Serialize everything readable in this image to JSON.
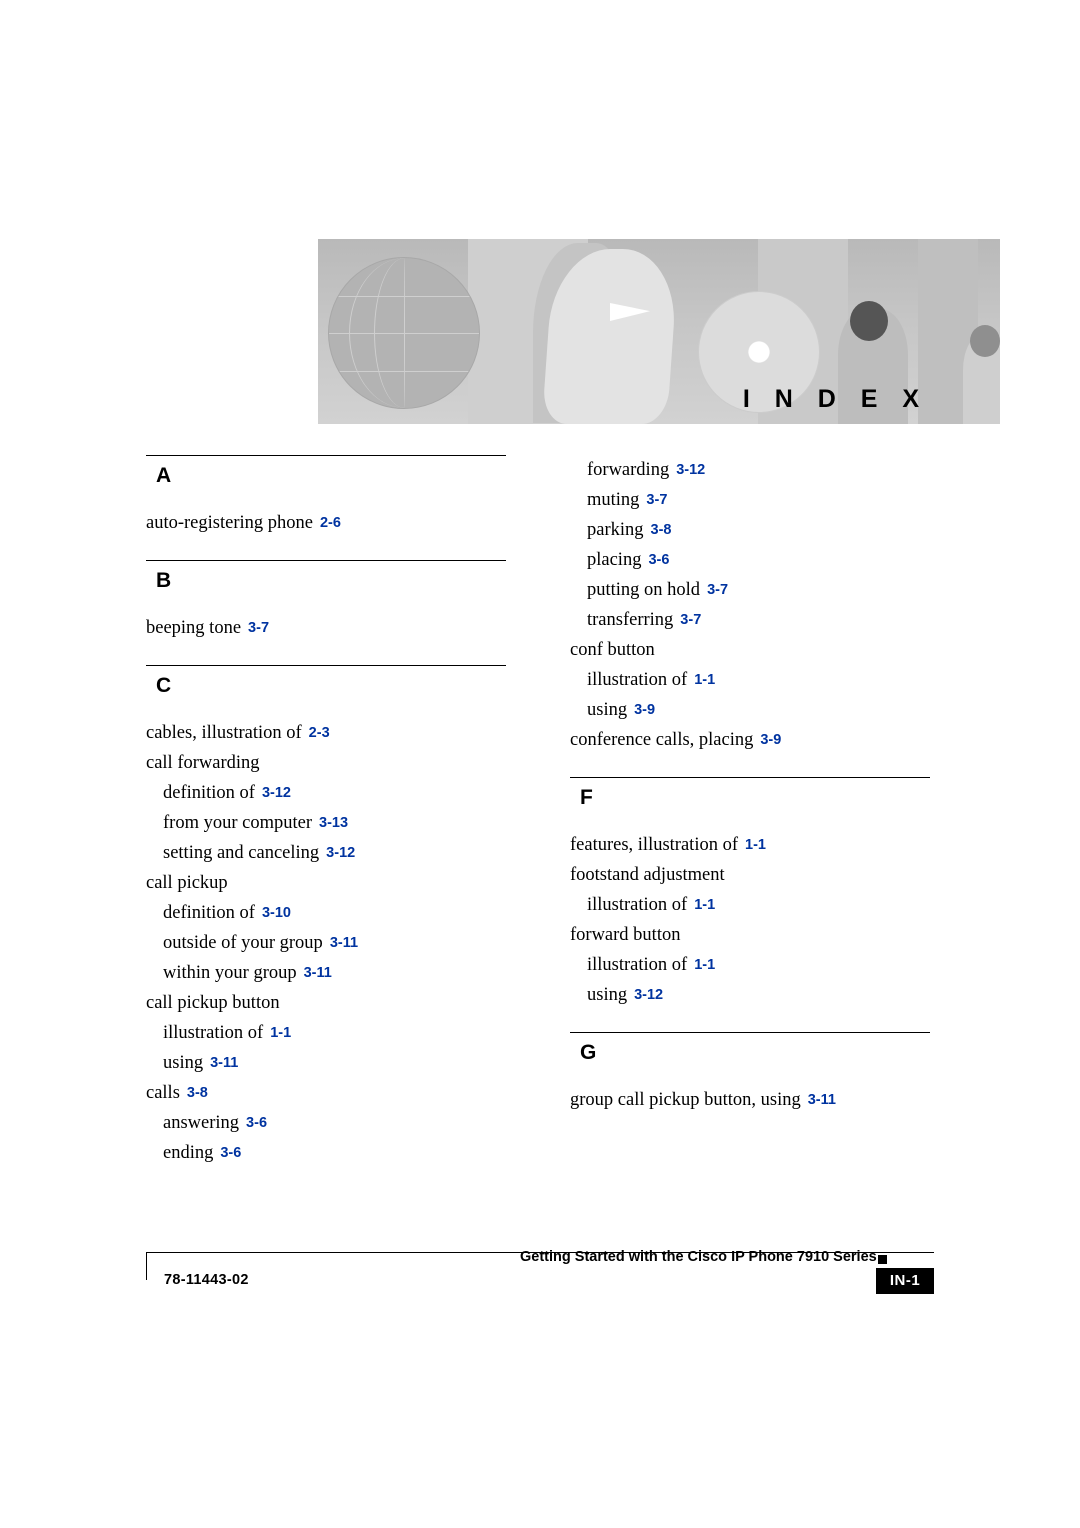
{
  "banner": {
    "title": "I N D E X",
    "graphic": "index-banner-illustration"
  },
  "columns": [
    {
      "id": "left",
      "sections": [
        {
          "letter": "A",
          "entries": [
            {
              "level": 0,
              "text": "auto-registering phone",
              "page": "2-6"
            }
          ]
        },
        {
          "letter": "B",
          "entries": [
            {
              "level": 0,
              "text": "beeping tone",
              "page": "3-7"
            }
          ]
        },
        {
          "letter": "C",
          "entries": [
            {
              "level": 0,
              "text": "cables, illustration of",
              "page": "2-3"
            },
            {
              "level": 0,
              "text": "call forwarding",
              "page": ""
            },
            {
              "level": 1,
              "text": "definition of",
              "page": "3-12"
            },
            {
              "level": 1,
              "text": "from your computer",
              "page": "3-13"
            },
            {
              "level": 1,
              "text": "setting and canceling",
              "page": "3-12"
            },
            {
              "level": 0,
              "text": "call pickup",
              "page": ""
            },
            {
              "level": 1,
              "text": "definition of",
              "page": "3-10"
            },
            {
              "level": 1,
              "text": "outside of your group",
              "page": "3-11"
            },
            {
              "level": 1,
              "text": "within your group",
              "page": "3-11"
            },
            {
              "level": 0,
              "text": "call pickup button",
              "page": ""
            },
            {
              "level": 1,
              "text": "illustration of",
              "page": "1-1"
            },
            {
              "level": 1,
              "text": "using",
              "page": "3-11"
            },
            {
              "level": 0,
              "text": "calls",
              "page": "3-8"
            },
            {
              "level": 1,
              "text": "answering",
              "page": "3-6"
            },
            {
              "level": 1,
              "text": "ending",
              "page": "3-6"
            }
          ]
        }
      ]
    },
    {
      "id": "right",
      "sections": [
        {
          "letter": "",
          "entries": [
            {
              "level": 1,
              "text": "forwarding",
              "page": "3-12"
            },
            {
              "level": 1,
              "text": "muting",
              "page": "3-7"
            },
            {
              "level": 1,
              "text": "parking",
              "page": "3-8"
            },
            {
              "level": 1,
              "text": "placing",
              "page": "3-6"
            },
            {
              "level": 1,
              "text": "putting on hold",
              "page": "3-7"
            },
            {
              "level": 1,
              "text": "transferring",
              "page": "3-7"
            },
            {
              "level": 0,
              "text": "conf button",
              "page": ""
            },
            {
              "level": 1,
              "text": "illustration of",
              "page": "1-1"
            },
            {
              "level": 1,
              "text": "using",
              "page": "3-9"
            },
            {
              "level": 0,
              "text": "conference calls, placing",
              "page": "3-9"
            }
          ]
        },
        {
          "letter": "F",
          "entries": [
            {
              "level": 0,
              "text": "features, illustration of",
              "page": "1-1"
            },
            {
              "level": 0,
              "text": "footstand adjustment",
              "page": ""
            },
            {
              "level": 1,
              "text": "illustration of",
              "page": "1-1"
            },
            {
              "level": 0,
              "text": "forward button",
              "page": ""
            },
            {
              "level": 1,
              "text": "illustration of",
              "page": "1-1"
            },
            {
              "level": 1,
              "text": "using",
              "page": "3-12"
            }
          ]
        },
        {
          "letter": "G",
          "entries": [
            {
              "level": 0,
              "text": "group call pickup button, using",
              "page": "3-11"
            }
          ]
        }
      ]
    }
  ],
  "footer": {
    "doc_number": "78-11443-02",
    "book_title": "Getting Started with the Cisco IP Phone 7910 Series",
    "page_label": "IN-1"
  },
  "colors": {
    "page_reference": "#0033a0",
    "text": "#000000",
    "footer_tab_bg": "#000000"
  }
}
